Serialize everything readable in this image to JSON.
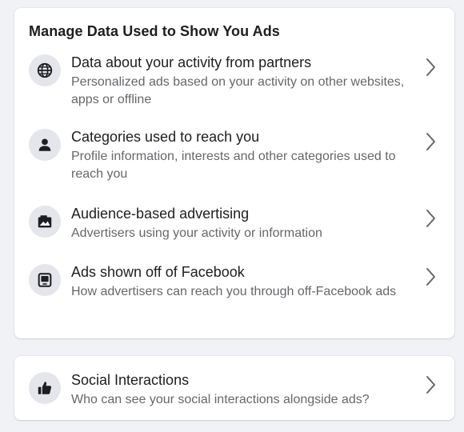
{
  "manage_card": {
    "title": "Manage Data Used to Show You Ads",
    "items": [
      {
        "icon": "globe-icon",
        "title": "Data about your activity from partners",
        "description": "Personalized ads based on your activity on other websites, apps or offline"
      },
      {
        "icon": "person-icon",
        "title": "Categories used to reach you",
        "description": "Profile information, interests and other categories used to reach you"
      },
      {
        "icon": "audience-icon",
        "title": "Audience-based advertising",
        "description": "Advertisers using your activity or information"
      },
      {
        "icon": "device-icon",
        "title": "Ads shown off of Facebook",
        "description": "How advertisers can reach you through off-Facebook ads"
      }
    ]
  },
  "social_card": {
    "items": [
      {
        "icon": "thumbs-up-icon",
        "title": "Social Interactions",
        "description": "Who can see your social interactions alongside ads?"
      }
    ]
  },
  "colors": {
    "page_background": "#f0f2f5",
    "card_background": "#ffffff",
    "icon_background": "#e4e6eb",
    "primary_text": "#1c1e21",
    "secondary_text": "#65676b"
  }
}
